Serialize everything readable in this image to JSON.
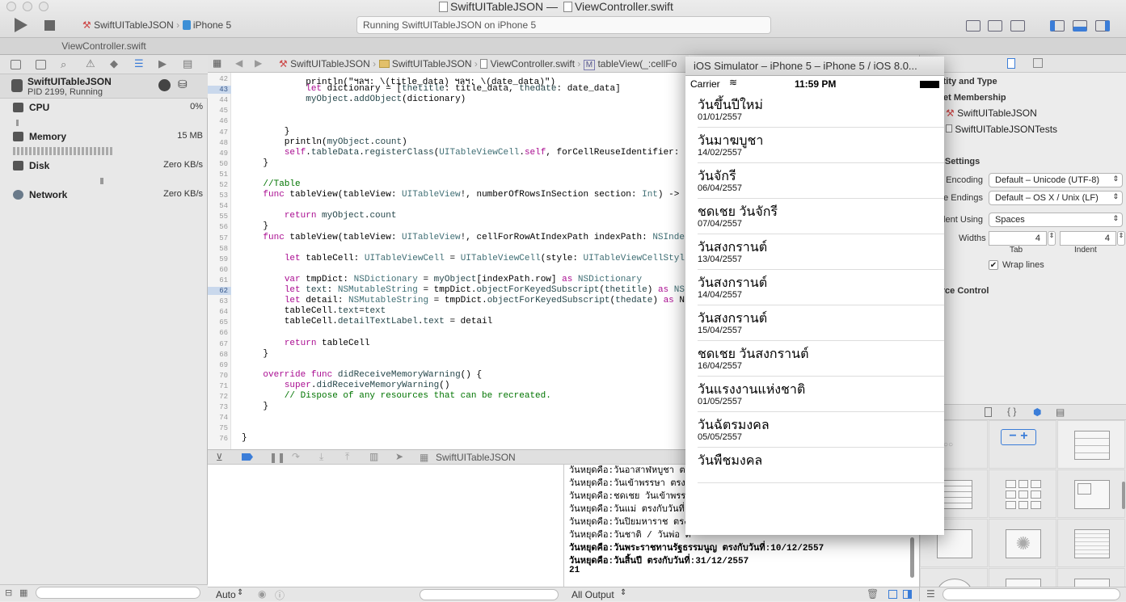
{
  "window": {
    "title_project": "SwiftUITableJSON",
    "title_sep": "—",
    "title_file": "ViewController.swift"
  },
  "toolbar": {
    "scheme": "SwiftUITableJSON",
    "device": "iPhone 5",
    "status": "Running SwiftUITableJSON on iPhone 5"
  },
  "tab": {
    "label": "ViewController.swift"
  },
  "debug_navigator": {
    "process_name": "SwiftUITableJSON",
    "process_status": "PID 2199, Running",
    "gauges": [
      {
        "label": "CPU",
        "value": "0%"
      },
      {
        "label": "Memory",
        "value": "15 MB"
      },
      {
        "label": "Disk",
        "value": "Zero KB/s"
      },
      {
        "label": "Network",
        "value": "Zero KB/s"
      }
    ]
  },
  "jumpbar": {
    "project": "SwiftUITableJSON",
    "group": "SwiftUITableJSON",
    "file": "ViewController.swift",
    "method_badge": "M",
    "method": "tableView(_:cellFo"
  },
  "code": [
    {
      "n": "42",
      "t": "            println(\"ฯลฯ: \\(title_data) ฯลฯ: \\(date_data)\")"
    },
    {
      "n": "43",
      "t": "            let dictionary = [thetitle: title_data, thedate: date_data]",
      "hl": true
    },
    {
      "n": "44",
      "t": "            myObject.addObject(dictionary)"
    },
    {
      "n": "45",
      "t": ""
    },
    {
      "n": "46",
      "t": ""
    },
    {
      "n": "47",
      "t": "        }"
    },
    {
      "n": "48",
      "t": "        println(myObject.count)"
    },
    {
      "n": "49",
      "t": "        self.tableData.registerClass(UITableViewCell.self, forCellReuseIdentifier:"
    },
    {
      "n": "50",
      "t": "    }"
    },
    {
      "n": "51",
      "t": ""
    },
    {
      "n": "52",
      "t": "    //Table"
    },
    {
      "n": "53",
      "t": "    func tableView(tableView: UITableView!, numberOfRowsInSection section: Int) ->"
    },
    {
      "n": "54",
      "t": ""
    },
    {
      "n": "55",
      "t": "        return myObject.count"
    },
    {
      "n": "56",
      "t": "    }"
    },
    {
      "n": "57",
      "t": "    func tableView(tableView: UITableView!, cellForRowAtIndexPath indexPath: NSInde"
    },
    {
      "n": "58",
      "t": ""
    },
    {
      "n": "59",
      "t": "        let tableCell: UITableViewCell = UITableViewCell(style: UITableViewCellStyl"
    },
    {
      "n": "60",
      "t": ""
    },
    {
      "n": "61",
      "t": "        var tmpDict: NSDictionary = myObject[indexPath.row] as NSDictionary"
    },
    {
      "n": "62",
      "t": "        let text: NSMutableString = tmpDict.objectForKeyedSubscript(thetitle) as NS",
      "hl": true
    },
    {
      "n": "63",
      "t": "        let detail: NSMutableString = tmpDict.objectForKeyedSubscript(thedate) as N"
    },
    {
      "n": "64",
      "t": "        tableCell.text=text"
    },
    {
      "n": "65",
      "t": "        tableCell.detailTextLabel.text = detail"
    },
    {
      "n": "66",
      "t": ""
    },
    {
      "n": "67",
      "t": "        return tableCell"
    },
    {
      "n": "68",
      "t": "    }"
    },
    {
      "n": "69",
      "t": ""
    },
    {
      "n": "70",
      "t": "    override func didReceiveMemoryWarning() {"
    },
    {
      "n": "71",
      "t": "        super.didReceiveMemoryWarning()"
    },
    {
      "n": "72",
      "t": "        // Dispose of any resources that can be recreated."
    },
    {
      "n": "73",
      "t": "    }"
    },
    {
      "n": "74",
      "t": ""
    },
    {
      "n": "75",
      "t": ""
    },
    {
      "n": "76",
      "t": "}"
    }
  ],
  "debugbar": {
    "target": "SwiftUITableJSON"
  },
  "console": {
    "lines": [
      "วันหยุดคือ:วันอาสาฬหบูชา ตรง",
      "วันหยุดคือ:วันเข้าพรรษา ตรง",
      "วันหยุดคือ:ชดเชย วันเข้าพรร",
      "วันหยุดคือ:วันแม่ ตรงกับวันที่:",
      "วันหยุดคือ:วันปิยมหาราช ตรง",
      "วันหยุดคือ:วันชาติ / วันพ่อ ต",
      "วันหยุดคือ:วันพระราชทานรัฐธรรมนูญ ตรงกับวันที่:10/12/2557",
      "วันหยุดคือ:วันสิ้นปี ตรงกับวันที่:31/12/2557",
      "21"
    ],
    "output_select": "All Output"
  },
  "vars": {
    "scope_select": "Auto"
  },
  "inspector": {
    "target_membership_header": "Target Membership",
    "identity_header": "Identity and Type",
    "targets": [
      "SwiftUITableJSON",
      "SwiftUITableJSONTests"
    ],
    "text_settings_header": "Text Settings",
    "text_encoding_label": "Text Encoding",
    "text_encoding_value": "Default – Unicode (UTF-8)",
    "line_endings_label": "Line Endings",
    "line_endings_value": "Default – OS X / Unix (LF)",
    "indent_using_label": "Indent Using",
    "indent_using_value": "Spaces",
    "widths_label": "Widths",
    "tab_value": "4",
    "indent_value": "4",
    "tab_label": "Tab",
    "indent_label": "Indent",
    "wrap_lines_label": "Wrap lines",
    "source_control_header": "Source Control"
  },
  "simulator": {
    "title": "iOS Simulator – iPhone 5 – iPhone 5 / iOS 8.0...",
    "carrier": "Carrier",
    "time": "11:59 PM",
    "rows": [
      {
        "title": "วันขึ้นปีใหม่",
        "date": "01/01/2557"
      },
      {
        "title": "วันมาฆบูชา",
        "date": "14/02/2557"
      },
      {
        "title": "วันจักรี",
        "date": "06/04/2557"
      },
      {
        "title": "ชดเชย วันจักรี",
        "date": "07/04/2557"
      },
      {
        "title": "วันสงกรานต์",
        "date": "13/04/2557"
      },
      {
        "title": "วันสงกรานต์",
        "date": "14/04/2557"
      },
      {
        "title": "วันสงกรานต์",
        "date": "15/04/2557"
      },
      {
        "title": "ชดเชย วันสงกรานต์",
        "date": "16/04/2557"
      },
      {
        "title": "วันแรงงานแห่งชาติ",
        "date": "01/05/2557"
      },
      {
        "title": "วันฉัตรมงคล",
        "date": "05/05/2557"
      },
      {
        "title": "วันพืชมงคล",
        "date": ""
      }
    ]
  },
  "colors": {
    "keyword": "#aa0d91",
    "type": "#3f6e74",
    "method": "#26474b",
    "comment": "#007400",
    "string": "#c41a16",
    "accent": "#3b7dd8"
  }
}
